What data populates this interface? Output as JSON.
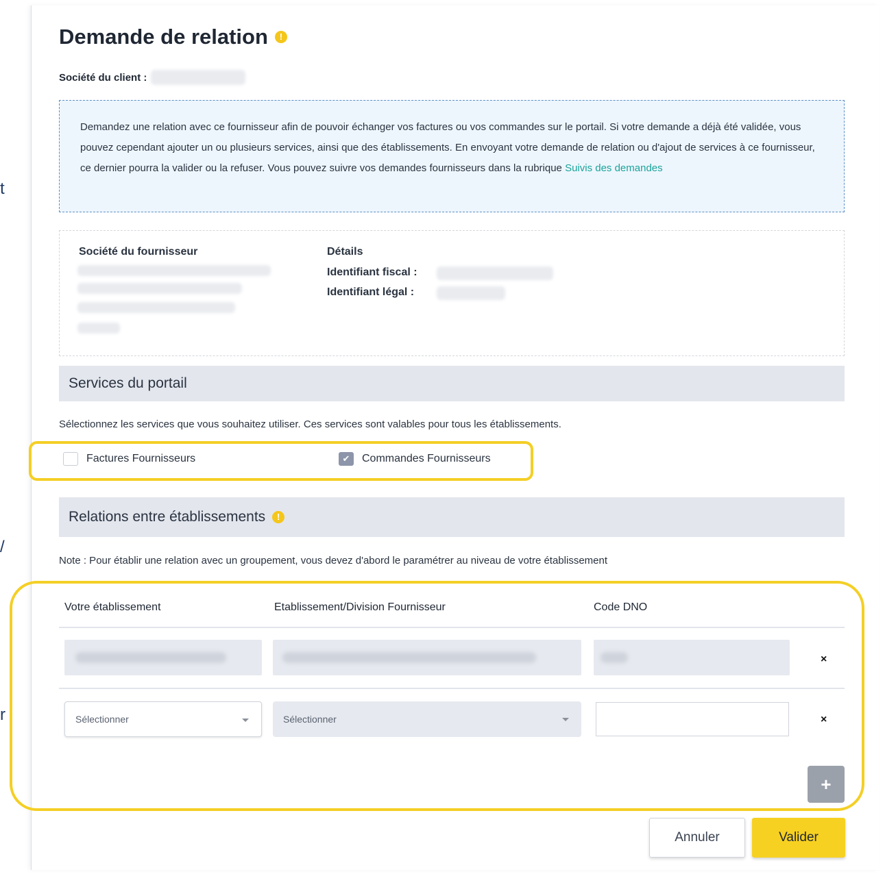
{
  "background_fragments": [
    "t",
    "/",
    "r"
  ],
  "modal": {
    "title": "Demande de relation",
    "client_label": "Société du client :",
    "info_text": "Demandez une relation avec ce fournisseur afin de pouvoir échanger vos factures ou vos commandes sur le portail. Si votre demande a déjà été validée, vous pouvez cependant ajouter un ou plusieurs services, ainsi que des établissements. En envoyant votre demande de relation ou d'ajout de services à ce fournisseur, ce dernier pourra la valider ou la refuser. Vous pouvez suivre vos demandes fournisseurs dans la rubrique",
    "info_link": "Suivis des demandes"
  },
  "supplier": {
    "company_label": "Société du fournisseur",
    "details_label": "Détails",
    "fiscal_id_label": "Identifiant fiscal :",
    "legal_id_label": "Identifiant légal :"
  },
  "services": {
    "section_title": "Services du portail",
    "description": "Sélectionnez les services que vous souhaitez utiliser. Ces services sont valables pour tous les établissements.",
    "options": [
      {
        "label": "Factures Fournisseurs",
        "checked": false
      },
      {
        "label": "Commandes Fournisseurs",
        "checked": true
      }
    ]
  },
  "relations": {
    "section_title": "Relations entre établissements",
    "note": "Note : Pour établir une relation avec un groupement, vous devez d'abord le paramétrer au niveau de votre établissement",
    "columns": [
      "Votre établissement",
      "Etablissement/Division Fournisseur",
      "Code DNO"
    ],
    "new_row": {
      "establishment_placeholder": "Sélectionner",
      "supplier_placeholder": "Sélectionner",
      "code_value": ""
    },
    "remove_symbol": "×",
    "add_symbol": "+"
  },
  "footer": {
    "cancel_label": "Annuler",
    "submit_label": "Valider"
  },
  "colors": {
    "accent_yellow": "#f7d121",
    "link_teal": "#1aa39a",
    "info_border": "#5b8fc7"
  }
}
